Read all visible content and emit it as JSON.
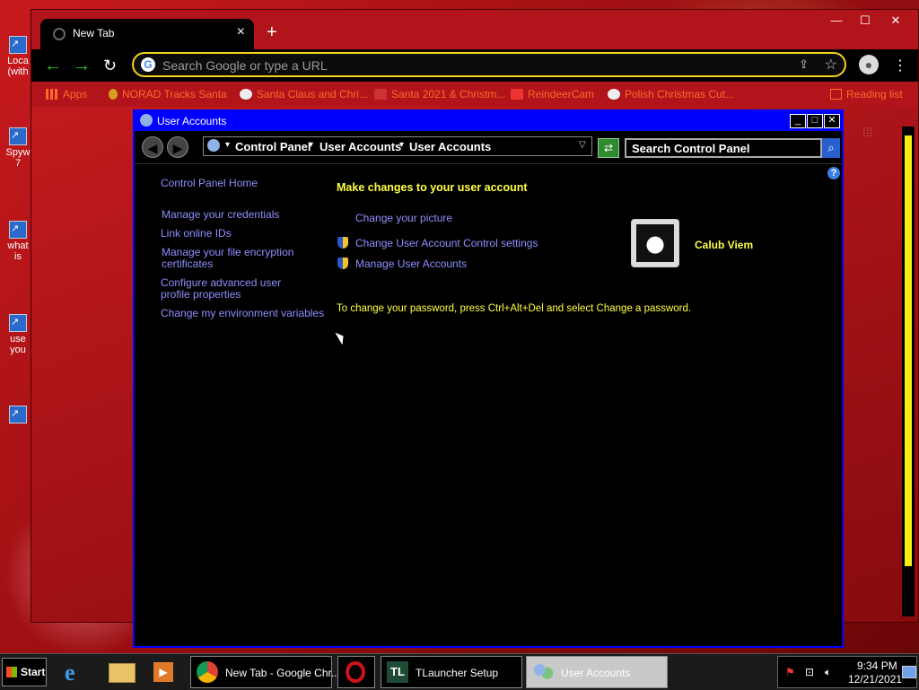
{
  "desktop": {
    "icons": [
      {
        "label": "Loca\n(with",
        "icon": "shortcut-icon"
      },
      {
        "label": "Spyw\n7",
        "icon": "shortcut-icon"
      },
      {
        "label": "what\nis",
        "icon": "shortcut-icon"
      },
      {
        "label": "use\nyou",
        "icon": "shortcut-icon"
      },
      {
        "label": "",
        "icon": "shortcut-icon"
      }
    ]
  },
  "chrome": {
    "tab_title": "New Tab",
    "omnibox_placeholder": "Search Google or type a URL",
    "bookmarks": [
      {
        "label": "Apps",
        "icon": "apps-grid-icon"
      },
      {
        "label": "NORAD Tracks Santa",
        "icon": "norad-icon"
      },
      {
        "label": "Santa Claus and Chri...",
        "icon": "globe-icon"
      },
      {
        "label": "Santa 2021 & Christm...",
        "icon": "santa-icon"
      },
      {
        "label": "ReindeerCam",
        "icon": "reindeer-icon"
      },
      {
        "label": "Polish Christmas Cut...",
        "icon": "globe-icon"
      },
      {
        "label": "Reading list",
        "icon": "reading-list-icon"
      }
    ],
    "colors": {
      "accent": "#f4d21a",
      "bookmark_text": "#ff6a2a"
    }
  },
  "user_accounts": {
    "window_title": "User Accounts",
    "breadcrumb": [
      "Control Panel",
      "User Accounts",
      "User Accounts"
    ],
    "search_value": "Search Control Panel",
    "sidebar_links": [
      "Control Panel Home",
      "Manage your credentials",
      "Link online IDs",
      "Manage your file encryption certificates",
      "Configure advanced user profile properties",
      "Change my environment variables"
    ],
    "heading": "Make changes to your user account",
    "tasks": [
      {
        "label": "Change your picture",
        "shield": false
      },
      {
        "label": "Change User Account Control settings",
        "shield": true
      },
      {
        "label": "Manage User Accounts",
        "shield": true
      }
    ],
    "password_note": "To change your password, press Ctrl+Alt+Del and select Change a password.",
    "user_name": "Calub Viem",
    "colors": {
      "title_bar": "#0000ff",
      "link": "#8f8fff",
      "highlight_text": "#ffff44"
    }
  },
  "taskbar": {
    "start_label": "Start",
    "tasks": [
      {
        "label": "New Tab - Google Chr...",
        "icon": "chrome-icon"
      },
      {
        "label": "",
        "icon": "opera-icon"
      },
      {
        "label": "TLauncher Setup",
        "icon": "tlauncher-icon"
      },
      {
        "label": "User Accounts",
        "icon": "user-accounts-icon"
      }
    ],
    "clock_time": "9:34 PM",
    "clock_date": "12/21/2021"
  }
}
